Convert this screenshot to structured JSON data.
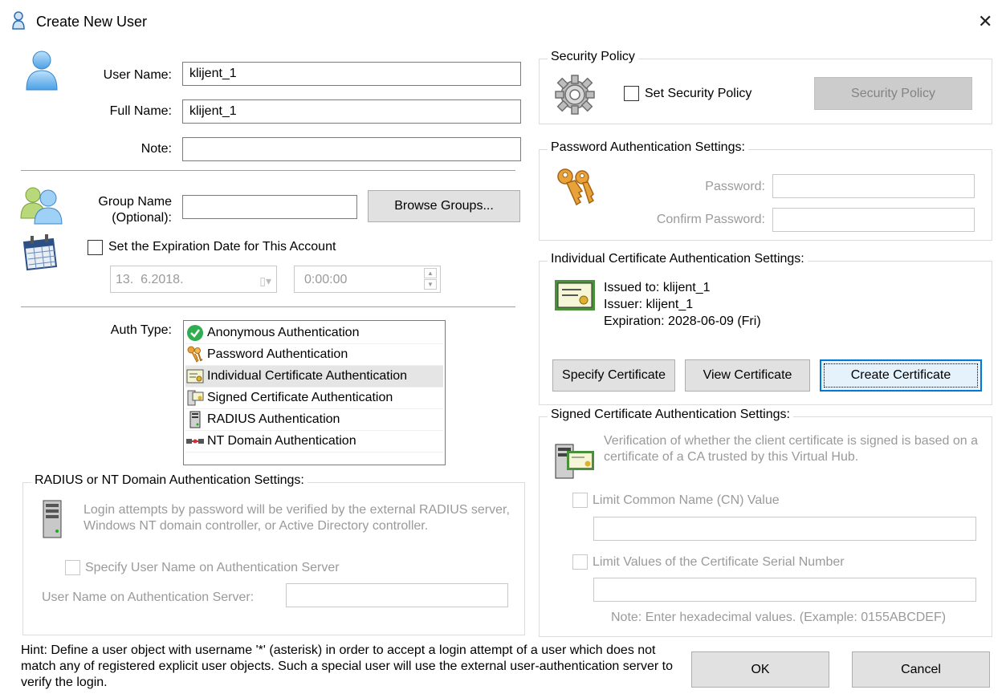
{
  "window": {
    "title": "Create New User",
    "close": "✕"
  },
  "user": {
    "username_label": "User Name:",
    "username_value": "klijent_1",
    "fullname_label": "Full Name:",
    "fullname_value": "klijent_1",
    "note_label": "Note:",
    "note_value": ""
  },
  "group": {
    "label_line1": "Group Name",
    "label_line2": "(Optional):",
    "value": "",
    "browse_button": "Browse Groups..."
  },
  "expiration": {
    "checkbox_label": "Set the Expiration Date for This Account",
    "checked": false,
    "date_value": "13.  6.2018.",
    "time_value": "0:00:00"
  },
  "auth": {
    "label": "Auth Type:",
    "items": [
      {
        "label": "Anonymous Authentication",
        "icon": "check-icon",
        "selected": false
      },
      {
        "label": "Password Authentication",
        "icon": "keys-icon",
        "selected": false
      },
      {
        "label": "Individual Certificate Authentication",
        "icon": "certificate-icon",
        "selected": true
      },
      {
        "label": "Signed Certificate Authentication",
        "icon": "signed-cert-icon",
        "selected": false
      },
      {
        "label": "RADIUS Authentication",
        "icon": "server-icon",
        "selected": false
      },
      {
        "label": "NT Domain Authentication",
        "icon": "network-icon",
        "selected": false
      }
    ]
  },
  "radius_group": {
    "title": "RADIUS or NT Domain Authentication Settings:",
    "description": "Login attempts by password will be verified by the external RADIUS server, Windows NT domain controller, or Active Directory controller.",
    "specify_label": "Specify User Name on Authentication Server",
    "server_user_label": "User Name on Authentication Server:",
    "server_user_value": ""
  },
  "hint": "Hint: Define a user object with username '*' (asterisk) in order to accept a login attempt of a user which does not match any of registered explicit user objects. Such a special user will use the external user-authentication server to verify the login.",
  "security_policy": {
    "title": "Security Policy",
    "checkbox_label": "Set Security Policy",
    "button": "Security Policy"
  },
  "password_settings": {
    "title": "Password Authentication Settings:",
    "password_label": "Password:",
    "confirm_label": "Confirm Password:"
  },
  "individual_cert": {
    "title": "Individual Certificate Authentication Settings:",
    "issued_to": "Issued to: klijent_1",
    "issuer": "Issuer: klijent_1",
    "expiration": "Expiration: 2028-06-09 (Fri)",
    "specify_button": "Specify Certificate",
    "view_button": "View Certificate",
    "create_button": "Create Certificate"
  },
  "signed_cert": {
    "title": "Signed Certificate Authentication Settings:",
    "description": "Verification of whether the client certificate is signed is based on a certificate of a CA trusted by this Virtual Hub.",
    "limit_cn_label": "Limit Common Name (CN) Value",
    "limit_serial_label": "Limit Values of the Certificate Serial Number",
    "note": "Note: Enter hexadecimal values. (Example: 0155ABCDEF)"
  },
  "footer": {
    "ok": "OK",
    "cancel": "Cancel"
  }
}
